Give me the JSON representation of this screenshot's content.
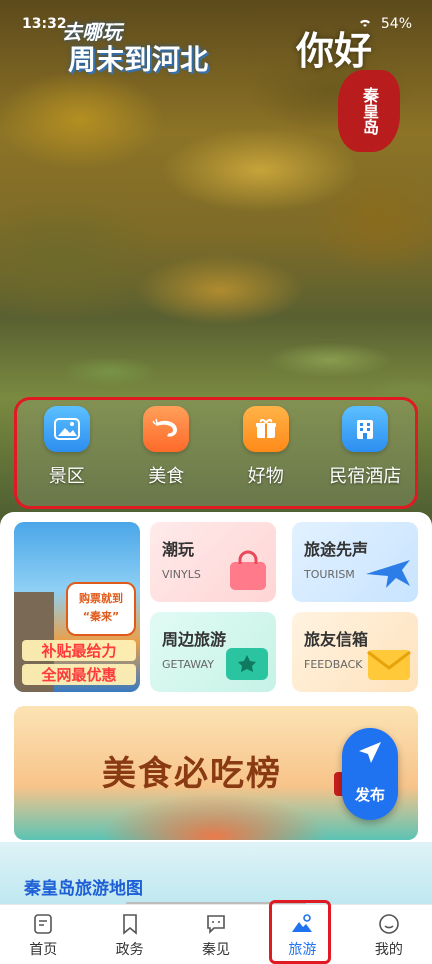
{
  "status_bar": {
    "time": "13:32",
    "battery": "54%"
  },
  "hero": {
    "title_line1": "去哪玩",
    "title_line2": "周末到河北",
    "brush_text": "你好",
    "seal_text": "秦皇岛"
  },
  "categories": [
    {
      "label": "景区",
      "icon": "mountain-icon",
      "color": "#3aa8f8"
    },
    {
      "label": "美食",
      "icon": "shrimp-icon",
      "color": "#ff7a3a"
    },
    {
      "label": "好物",
      "icon": "gift-icon",
      "color": "#ff9a2a"
    },
    {
      "label": "民宿酒店",
      "icon": "building-icon",
      "color": "#3aa8f8"
    }
  ],
  "promo": {
    "bubble_line1": "购票就到",
    "bubble_line2": "“秦来”",
    "line1": "补贴最给力",
    "line2": "全网最优惠"
  },
  "tiles": [
    {
      "title": "潮玩",
      "subtitle": "VINYLS"
    },
    {
      "title": "旅途先声",
      "subtitle": "TOURISM"
    },
    {
      "title": "周边旅游",
      "subtitle": "GETAWAY"
    },
    {
      "title": "旅友信箱",
      "subtitle": "FEEDBACK"
    }
  ],
  "food_banner": {
    "title": "美食必吃榜"
  },
  "map": {
    "title": "秦皇岛旅游地图"
  },
  "fab": {
    "label": "发布"
  },
  "tabs": [
    {
      "label": "首页",
      "icon": "home-doc-icon",
      "active": false
    },
    {
      "label": "政务",
      "icon": "bookmark-icon",
      "active": false
    },
    {
      "label": "秦见",
      "icon": "chat-icon",
      "active": false
    },
    {
      "label": "旅游",
      "icon": "travel-icon",
      "active": true
    },
    {
      "label": "我的",
      "icon": "smile-icon",
      "active": false
    }
  ],
  "colors": {
    "accent": "#1f73f0",
    "highlight": "#e01a22"
  }
}
